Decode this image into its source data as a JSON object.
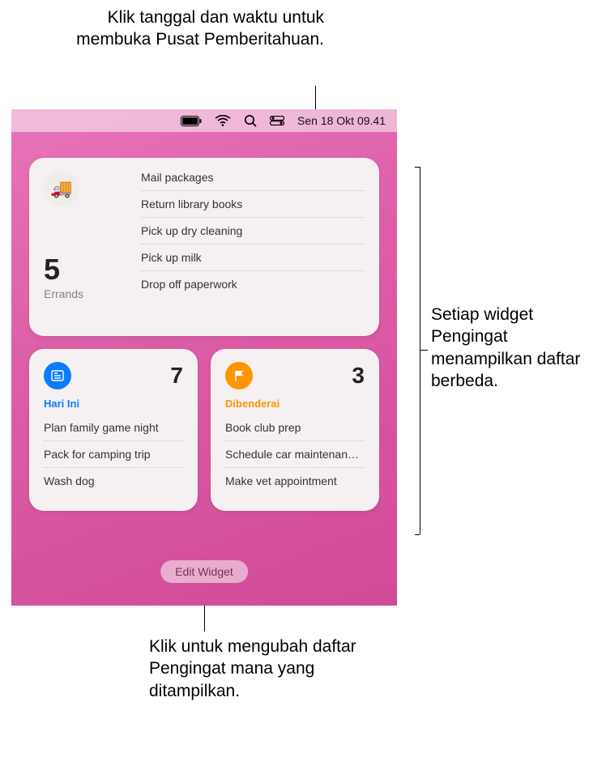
{
  "callouts": {
    "top": "Klik tanggal dan waktu untuk membuka Pusat Pemberitahuan.",
    "right": "Setiap widget Pengingat menampilkan daftar berbeda.",
    "bottom": "Klik untuk mengubah daftar Pengingat mana yang ditampilkan."
  },
  "menubar": {
    "datetime": "Sen 18 Okt  09.41"
  },
  "widget_large": {
    "icon": "delivery-truck",
    "count": "5",
    "title": "Errands",
    "items": [
      "Mail packages",
      "Return library books",
      "Pick up dry cleaning",
      "Pick up milk",
      "Drop off paperwork"
    ]
  },
  "widget_today": {
    "count": "7",
    "title": "Hari Ini",
    "items": [
      "Plan family game night",
      "Pack for camping trip",
      "Wash dog"
    ]
  },
  "widget_flagged": {
    "count": "3",
    "title": "Dibenderai",
    "items": [
      "Book club prep",
      "Schedule car maintenan…",
      "Make vet appointment"
    ]
  },
  "edit_button": "Edit Widget"
}
